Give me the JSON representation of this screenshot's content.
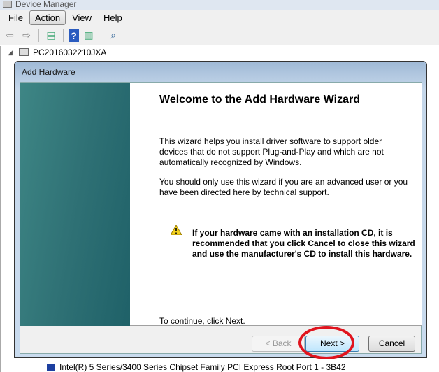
{
  "window": {
    "title": "Device Manager"
  },
  "menu": [
    "File",
    "Action",
    "View",
    "Help"
  ],
  "menu_active": "Action",
  "toolbar": {
    "icons": [
      "back-arrow-icon",
      "forward-arrow-icon",
      "console-tree-icon",
      "help-icon",
      "action-pane-icon",
      "scan-hardware-icon"
    ]
  },
  "tree": {
    "root": "PC2016032210JXA",
    "item": "Intel(R) 5 Series/3400 Series Chipset Family PCI Express Root Port 1 - 3B42"
  },
  "dialog": {
    "title": "Add Hardware",
    "heading": "Welcome to the Add Hardware Wizard",
    "para1": "This wizard helps you install driver software to support older devices that do not support Plug-and-Play and which are not automatically recognized by Windows.",
    "para2": "You should only use this wizard if you are an advanced user or you have been directed here by technical support.",
    "warning": "If your hardware came with an installation CD, it is recommended that you click Cancel to close this wizard and use the manufacturer's CD to install this hardware.",
    "continue": "To continue, click Next.",
    "buttons": {
      "back": "< Back",
      "next": "Next >",
      "cancel": "Cancel"
    }
  },
  "colors": {
    "highlight_circle": "#e0141e",
    "side_panel": "#2f7175"
  }
}
